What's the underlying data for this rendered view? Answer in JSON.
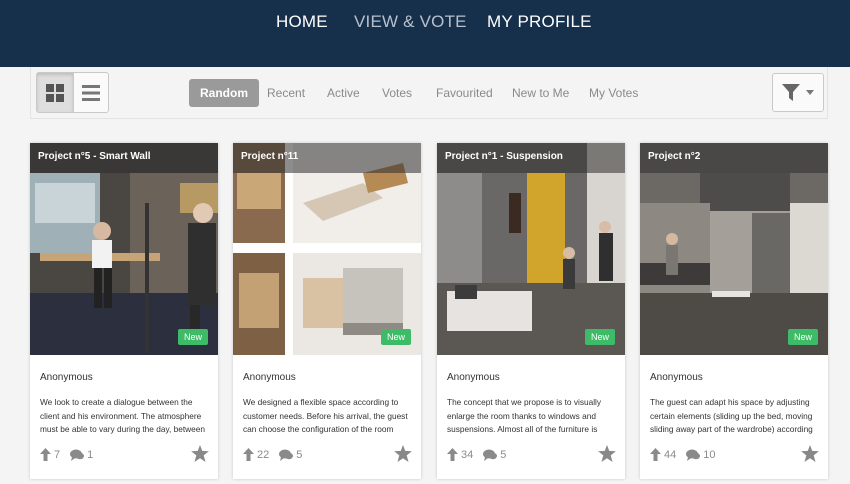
{
  "nav": {
    "home": "HOME",
    "view_vote": "VIEW & VOTE",
    "profile": "MY PROFILE"
  },
  "sort_tabs": [
    "Random",
    "Recent",
    "Active",
    "Votes",
    "Favourited",
    "New to Me",
    "My Votes"
  ],
  "active_sort": "Random",
  "colors": {
    "nav_bg": "#162f4b",
    "badge_green": "#3dbb66",
    "icon_grey": "#8a8a8a"
  },
  "cards": [
    {
      "title": "Project n°5 - Smart Wall",
      "badge": "New",
      "author": "Anonymous",
      "desc": "We look to create a dialogue between the client and his environment. The atmosphere must be able to vary during the day, between",
      "votes": "7",
      "comments": "1"
    },
    {
      "title": "Project n°11",
      "badge": "New",
      "author": "Anonymous",
      "desc": "We designed a flexible space according to customer needs. Before his arrival, the guest can choose the configuration of the room",
      "votes": "22",
      "comments": "5"
    },
    {
      "title": "Project n°1 - Suspension",
      "badge": "New",
      "author": "Anonymous",
      "desc": "The concept that we propose is to visually enlarge the room thanks to windows and suspensions. Almost all of the furniture is",
      "votes": "34",
      "comments": "5"
    },
    {
      "title": "Project n°2",
      "badge": "New",
      "author": "Anonymous",
      "desc": "The guest can adapt his space by adjusting certain elements (sliding up the bed, moving sliding away part of the wardrobe) according",
      "votes": "44",
      "comments": "10"
    }
  ]
}
